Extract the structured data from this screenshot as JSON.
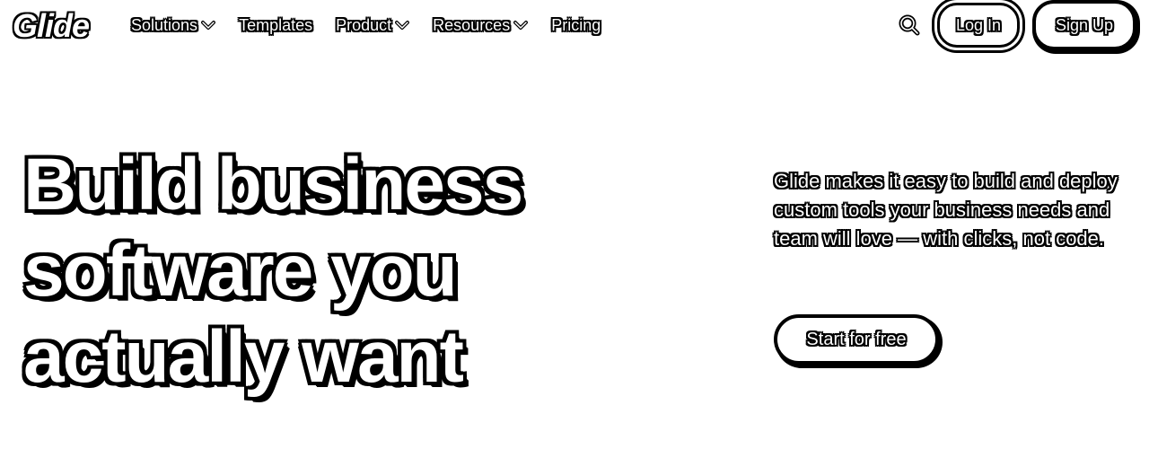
{
  "brand": {
    "logo_text": "Glide"
  },
  "nav": {
    "items": [
      {
        "label": "Solutions",
        "has_dropdown": true
      },
      {
        "label": "Templates",
        "has_dropdown": false
      },
      {
        "label": "Product",
        "has_dropdown": true
      },
      {
        "label": "Resources",
        "has_dropdown": true
      },
      {
        "label": "Pricing",
        "has_dropdown": false
      }
    ],
    "search_icon": "search-icon",
    "login_label": "Log In",
    "signup_label": "Sign Up"
  },
  "hero": {
    "title_lines": [
      "Build business",
      "software you",
      "actually want"
    ],
    "description": "Glide makes it easy to build and deploy custom tools your business needs and team will love — with clicks, not code.",
    "cta_label": "Start for free"
  },
  "colors": {
    "background": "#ffffff",
    "text_fill": "#ffffff",
    "outline": "#000000"
  }
}
